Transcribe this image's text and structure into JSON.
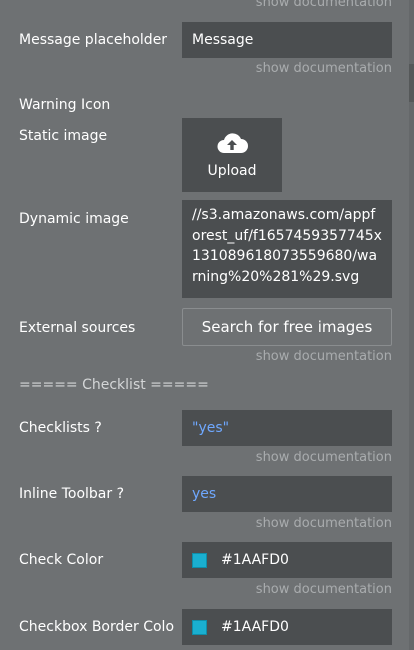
{
  "doc_link": "show documentation",
  "message_placeholder": {
    "label": "Message placeholder",
    "value": "Message"
  },
  "warning_icon": {
    "heading": "Warning Icon"
  },
  "static_image": {
    "label": "Static image",
    "upload_label": "Upload",
    "icon": "cloud-upload-icon"
  },
  "dynamic_image": {
    "label": "Dynamic image",
    "value": "//s3.amazonaws.com/appforest_uf/f1657459357745x131089618073559680/warning%20%281%29.svg"
  },
  "external_sources": {
    "label": "External sources",
    "button_label": "Search for free images"
  },
  "checklist_section": {
    "heading": "===== Checklist ====="
  },
  "checklists": {
    "label": "Checklists ?",
    "value": "\"yes\""
  },
  "inline_toolbar": {
    "label": "Inline Toolbar ?",
    "value": "yes"
  },
  "check_color": {
    "label": "Check Color",
    "value": "#1AAFD0",
    "swatch": "#1AAFD0"
  },
  "checkbox_border_color": {
    "label": "Checkbox Border Colo",
    "value": "#1AAFD0",
    "swatch": "#1AAFD0"
  }
}
